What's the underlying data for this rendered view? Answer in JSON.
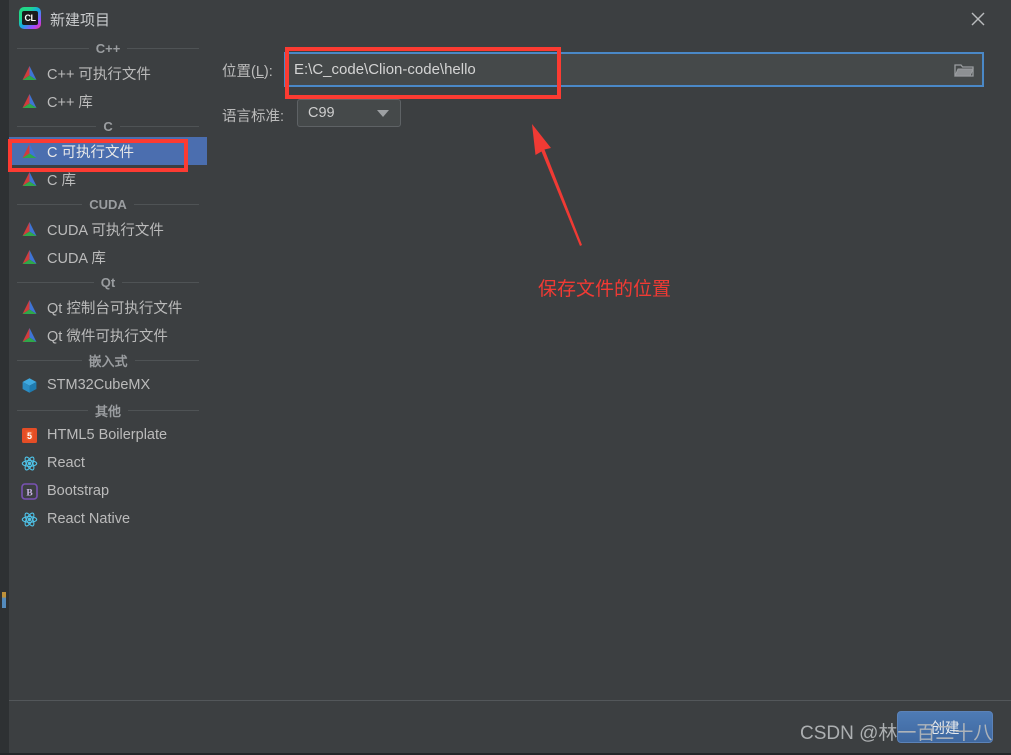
{
  "window": {
    "title": "新建项目",
    "logo_icon": "clion-logo-icon",
    "close_icon": "close-icon"
  },
  "sidebar": {
    "groups": [
      {
        "label": "C++",
        "items": [
          {
            "label": "C++ 可执行文件",
            "icon": "pyramid-icon",
            "selected": false
          },
          {
            "label": "C++ 库",
            "icon": "pyramid-icon",
            "selected": false
          }
        ]
      },
      {
        "label": "C",
        "items": [
          {
            "label": "C 可执行文件",
            "icon": "pyramid-icon",
            "selected": true
          },
          {
            "label": "C 库",
            "icon": "pyramid-icon",
            "selected": false
          }
        ]
      },
      {
        "label": "CUDA",
        "items": [
          {
            "label": "CUDA 可执行文件",
            "icon": "pyramid-icon",
            "selected": false
          },
          {
            "label": "CUDA 库",
            "icon": "pyramid-icon",
            "selected": false
          }
        ]
      },
      {
        "label": "Qt",
        "items": [
          {
            "label": "Qt 控制台可执行文件",
            "icon": "pyramid-icon",
            "selected": false
          },
          {
            "label": "Qt 微件可执行文件",
            "icon": "pyramid-icon",
            "selected": false
          }
        ]
      },
      {
        "label": "嵌入式",
        "items": [
          {
            "label": "STM32CubeMX",
            "icon": "cube-icon",
            "selected": false
          }
        ]
      },
      {
        "label": "其他",
        "items": [
          {
            "label": "HTML5 Boilerplate",
            "icon": "html5-icon",
            "selected": false
          },
          {
            "label": "React",
            "icon": "react-icon",
            "selected": false
          },
          {
            "label": "Bootstrap",
            "icon": "bootstrap-icon",
            "selected": false
          },
          {
            "label": "React Native",
            "icon": "react-icon",
            "selected": false
          }
        ]
      }
    ]
  },
  "form": {
    "location_label_prefix": "位置(",
    "location_label_mnemonic": "L",
    "location_label_suffix": "):",
    "location_value": "E:\\C_code\\Clion-code\\hello",
    "location_placeholder": "",
    "browse_icon": "folder-icon",
    "standard_label": "语言标准:",
    "standard_value": "C99",
    "standard_arrow_icon": "chevron-down-icon"
  },
  "annotations": {
    "note_text": "保存文件的位置",
    "arrow_icon": "arrow-up-left-icon",
    "highlight_color": "#fc3b32"
  },
  "footer": {
    "create_label": "创建",
    "watermark": "CSDN @林一百二十八"
  },
  "colors": {
    "window_bg": "#3c3f41",
    "selection_blue": "#4b6eaf",
    "field_focus_border": "#4a88c7",
    "annotation_red": "#fc3b32",
    "button_blue": "#4e7bb5",
    "text_primary": "#bbbbbb",
    "text_muted": "#9a9da0"
  }
}
